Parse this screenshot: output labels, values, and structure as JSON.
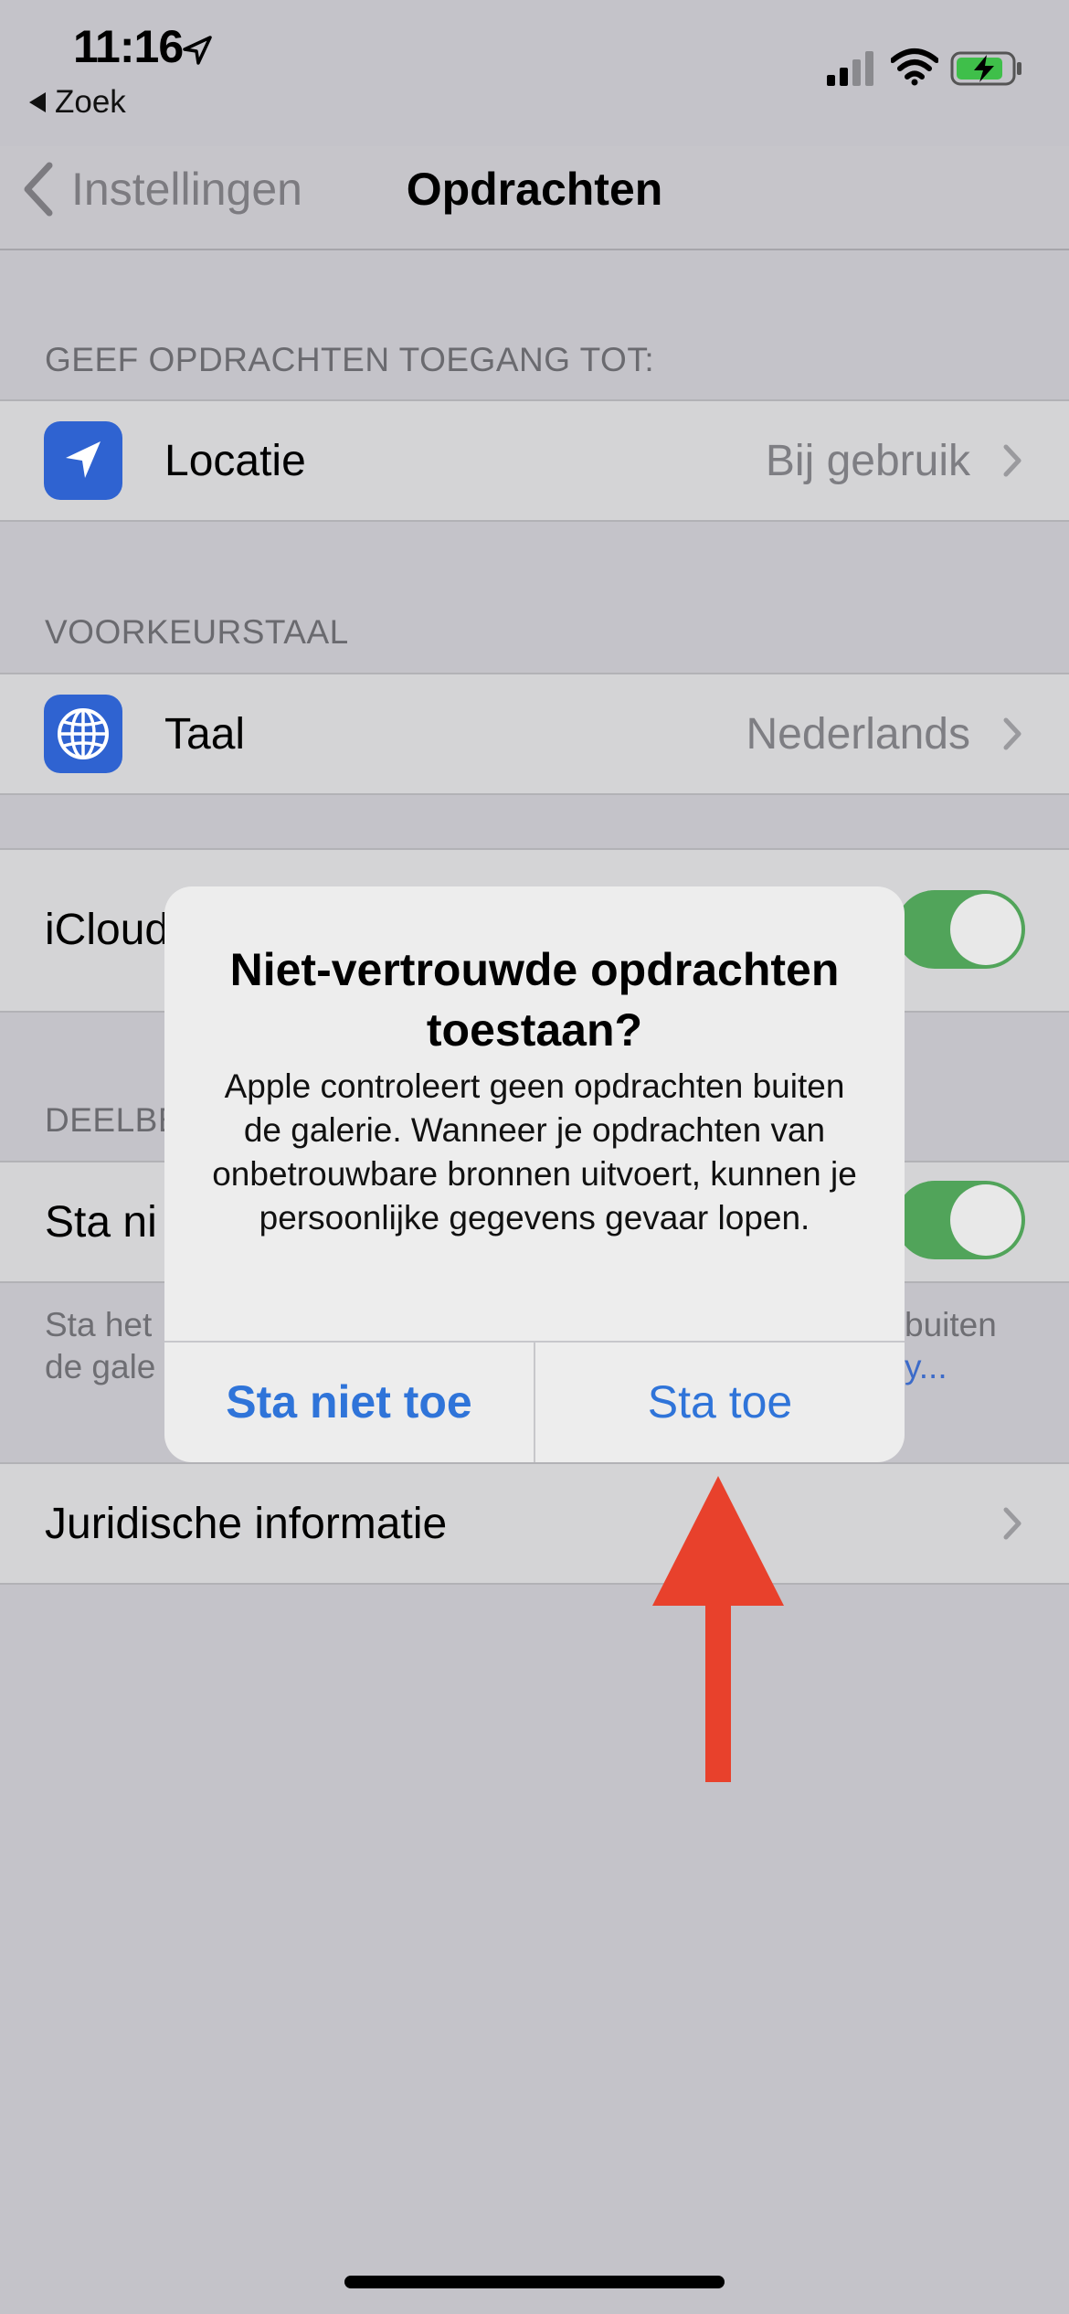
{
  "status_bar": {
    "time": "11:16",
    "back_app_label": "Zoek"
  },
  "nav": {
    "back_label": "Instellingen",
    "title": "Opdrachten"
  },
  "sections": {
    "access_header": "GEEF OPDRACHTEN TOEGANG TOT:",
    "location": {
      "label": "Locatie",
      "value": "Bij gebruik"
    },
    "language_header": "VOORKEURSTAAL",
    "language": {
      "label": "Taal",
      "value": "Nederlands"
    },
    "icloud": {
      "label_visible": "iCloud",
      "toggle_on": true
    },
    "sharing_header_visible": "DEELBE",
    "untrusted": {
      "label_visible": "Sta ni",
      "toggle_on": true
    },
    "footer_left_line1": "Sta het",
    "footer_left_line2": "de gale",
    "footer_right_line1": "buiten",
    "footer_right_line2": "y...",
    "legal": {
      "label": "Juridische informatie"
    }
  },
  "alert": {
    "title": "Niet-vertrouwde opdrachten toestaan?",
    "message": "Apple controleert geen opdrachten buiten de galerie. Wanneer je opdrachten van onbetrouwbare bronnen uitvoert, kunnen je persoonlijke gegevens gevaar lopen.",
    "deny_label": "Sta niet toe",
    "allow_label": "Sta toe"
  },
  "colors": {
    "accent_blue": "#2f74d9",
    "toggle_green": "#51a45a",
    "annotation_red": "#e8412c",
    "icon_blue": "#2f63d1"
  },
  "icons": {
    "location": "location-arrow-icon",
    "language": "globe-icon"
  }
}
